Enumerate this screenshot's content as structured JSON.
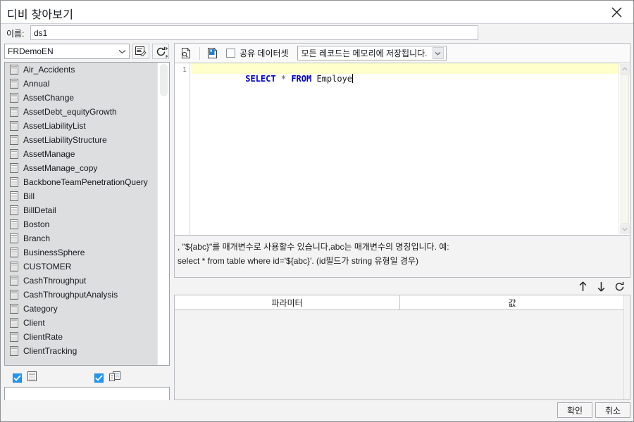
{
  "window": {
    "title": "디비 찾아보기",
    "close_icon": "close-icon"
  },
  "name_row": {
    "label": "이름:",
    "value": "ds1",
    "placeholder": ""
  },
  "left_panel": {
    "connection": {
      "selected": "FRDemoEN",
      "edit_icon": "edit-connection-icon",
      "refresh_icon": "refresh-icon",
      "splitter_icon": "splitter-arrows-icon"
    },
    "tables": [
      "Air_Accidents",
      "Annual",
      "AssetChange",
      "AssetDebt_equityGrowth",
      "AssetLiabilityList",
      "AssetLiabilityStructure",
      "AssetManage",
      "AssetManage_copy",
      "BackboneTeamPenetrationQuery",
      "Bill",
      "BillDetail",
      "Boston",
      "Branch",
      "BusinessSphere",
      "CUSTOMER",
      "CashThroughput",
      "CashThroughputAnalysis",
      "Category",
      "Client",
      "ClientRate",
      "ClientTracking"
    ],
    "table_icon": "table-icon",
    "filters": [
      {
        "name": "show-tables",
        "checked": true,
        "icon": "table-grid-icon"
      },
      {
        "name": "show-views",
        "checked": true,
        "icon": "view-icon"
      }
    ],
    "search_value": "",
    "search_placeholder": ""
  },
  "sql_toolbar": {
    "preview_icon": "preview-document-icon",
    "save_icon": "save-document-icon",
    "shared_dataset": {
      "label": "공유 데이터셋",
      "checked": false
    },
    "memory_select": {
      "selected": "모든 레코드는 메모리에 저장됩니다."
    }
  },
  "editor": {
    "line_numbers": [
      "1"
    ],
    "sql": "SELECT * FROM Employe",
    "tokens": [
      {
        "text": "SELECT",
        "type": "keyword"
      },
      {
        "text": " ",
        "type": "plain"
      },
      {
        "text": "*",
        "type": "operator"
      },
      {
        "text": " ",
        "type": "plain"
      },
      {
        "text": "FROM",
        "type": "keyword"
      },
      {
        "text": " ",
        "type": "plain"
      },
      {
        "text": "Employe",
        "type": "identifier"
      }
    ],
    "scroll_up_icon": "scroll-up-icon",
    "scroll_down_icon": "scroll-down-icon"
  },
  "hint": {
    "line1": ", \"${abc}\"를 매개변수로 사용할수 있습니다,abc는 매개변수의 명칭입니다. 예:",
    "line2": "select * from table where id='${abc}'. (id필드가 string 유형일 경우)"
  },
  "param_toolbar": {
    "move_up_icon": "arrow-up-icon",
    "move_down_icon": "arrow-down-icon",
    "refresh_icon": "refresh-icon"
  },
  "param_table": {
    "columns": [
      "파라미터",
      "값"
    ],
    "rows": []
  },
  "footer": {
    "ok_label": "확인",
    "cancel_label": "취소"
  },
  "colors": {
    "accent": "#2196f3",
    "keyword": "#0000c8",
    "editor_line_highlight": "#ffffcc",
    "dialog_bg": "#f3f3f4",
    "list_bg": "#dcdedf"
  }
}
